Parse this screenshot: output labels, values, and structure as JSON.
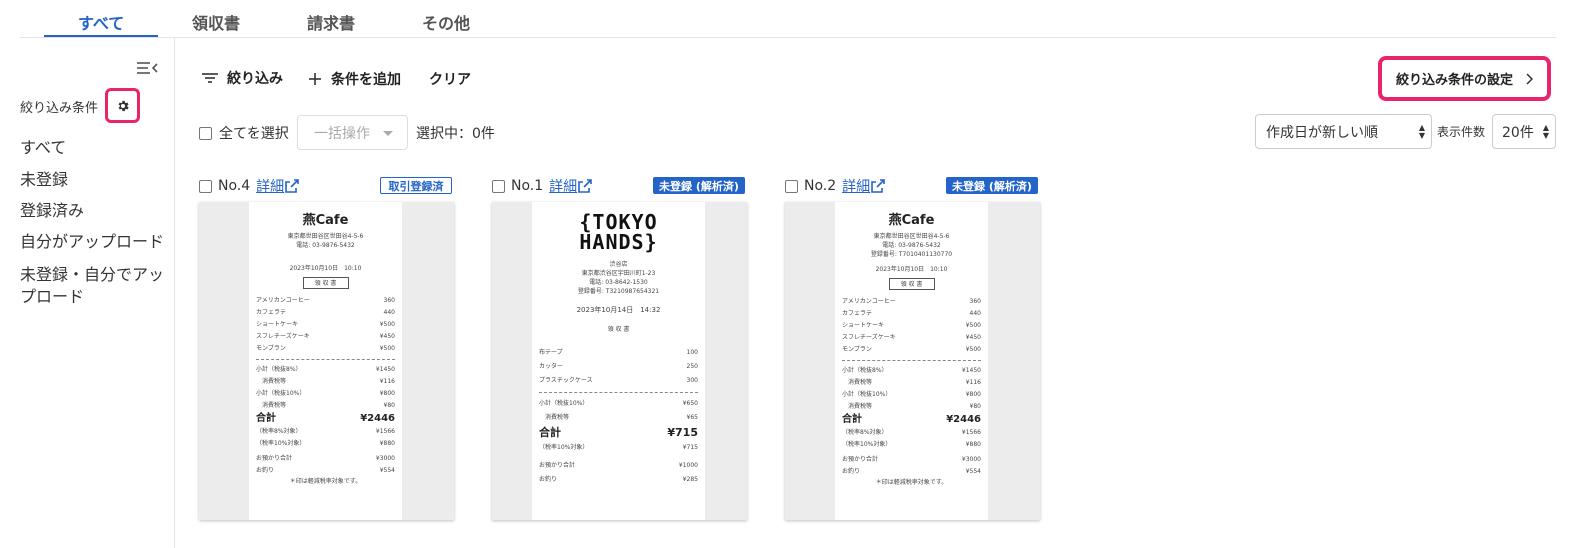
{
  "tabs": [
    {
      "label": "すべて"
    },
    {
      "label": "領収書"
    },
    {
      "label": "請求書"
    },
    {
      "label": "その他"
    }
  ],
  "colors": {
    "accent": "#2463c7",
    "highlight": "#e8246c"
  },
  "sidebar": {
    "header": "絞り込み条件",
    "items": [
      {
        "label": "すべて"
      },
      {
        "label": "未登録"
      },
      {
        "label": "登録済み"
      },
      {
        "label": "自分がアップロード"
      },
      {
        "label": "未登録・自分でアップロード"
      }
    ]
  },
  "toolbar": {
    "filter_label": "絞り込み",
    "add_condition_label": "条件を追加",
    "clear_label": "クリア",
    "filter_settings_label": "絞り込み条件の設定",
    "select_all_label": "全てを選択",
    "bulk_action_label": "一括操作",
    "selected_count_label": "選択中：0件",
    "sort_value": "作成日が新しい順",
    "per_page_label": "表示件数",
    "per_page_value": "20件"
  },
  "cards": [
    {
      "number": "No.4",
      "detail_label": "詳細",
      "badge": "取引登録済",
      "receipt": {
        "store": "燕Cafe",
        "address": "東京都世田谷区世田谷4-5-6",
        "phone": "電話: 03-9876-5432",
        "datetime": "2023年10月10日　10:10",
        "doc_title": "領 収 書",
        "items": [
          {
            "name": "アメリカンコーヒー",
            "price": "360"
          },
          {
            "name": "カフェラテ",
            "price": "440"
          },
          {
            "name": "ショートケーキ",
            "price": "¥500"
          },
          {
            "name": "スフレチーズケーキ",
            "price": "¥450"
          },
          {
            "name": "モンブラン",
            "price": "¥500"
          }
        ],
        "subtotals": [
          {
            "name": "小計（税抜8%）",
            "price": "¥1450"
          },
          {
            "name": "　消費税等",
            "price": "¥116"
          },
          {
            "name": "小計（税抜10%）",
            "price": "¥800"
          },
          {
            "name": "　消費税等",
            "price": "¥80"
          }
        ],
        "total_label": "合計",
        "total": "¥2446",
        "tax_breakdown": [
          {
            "name": "（税率8%対象）",
            "price": "¥1566"
          },
          {
            "name": "（税率10%対象）",
            "price": "¥880"
          }
        ],
        "payment": [
          {
            "name": "お預かり合計",
            "price": "¥3000"
          },
          {
            "name": "お釣り",
            "price": "¥554"
          }
        ],
        "note": "＊印は軽減税率対象です。"
      }
    },
    {
      "number": "No.1",
      "detail_label": "詳細",
      "badge": "未登録 (解析済)",
      "receipt": {
        "logo_line1": "{TOKYO",
        "logo_line2": "HANDS}",
        "store": "渋谷店",
        "address": "東京都渋谷区宇田川町1-23",
        "phone": "電話: 03-8642-1530",
        "registration": "登録番号: T3210987654321",
        "datetime": "2023年10月14日　14:32",
        "doc_title": "領 収 書",
        "items": [
          {
            "name": "布テープ",
            "price": "100"
          },
          {
            "name": "カッター",
            "price": "250"
          },
          {
            "name": "プラスチックケース",
            "price": "300"
          }
        ],
        "subtotals": [
          {
            "name": "小計（税抜10%）",
            "price": "¥650"
          },
          {
            "name": "　消費税等",
            "price": "¥65"
          }
        ],
        "total_label": "合計",
        "total": "¥715",
        "tax_breakdown": [
          {
            "name": "（税率10%対象）",
            "price": "¥715"
          }
        ],
        "payment": [
          {
            "name": "お預かり合計",
            "price": "¥1000"
          },
          {
            "name": "お釣り",
            "price": "¥285"
          }
        ]
      }
    },
    {
      "number": "No.2",
      "detail_label": "詳細",
      "badge": "未登録 (解析済)",
      "receipt": {
        "store": "燕Cafe",
        "address": "東京都世田谷区世田谷4-5-6",
        "phone": "電話: 03-9876-5432",
        "registration": "登録番号: T7010401130770",
        "datetime": "2023年10月10日　10:10",
        "doc_title": "領 収 書",
        "items": [
          {
            "name": "アメリカンコーヒー",
            "price": "360"
          },
          {
            "name": "カフェラテ",
            "price": "440"
          },
          {
            "name": "ショートケーキ",
            "price": "¥500"
          },
          {
            "name": "スフレチーズケーキ",
            "price": "¥450"
          },
          {
            "name": "モンブラン",
            "price": "¥500"
          }
        ],
        "subtotals": [
          {
            "name": "小計（税抜8%）",
            "price": "¥1450"
          },
          {
            "name": "　消費税等",
            "price": "¥116"
          },
          {
            "name": "小計（税抜10%）",
            "price": "¥800"
          },
          {
            "name": "　消費税等",
            "price": "¥80"
          }
        ],
        "total_label": "合計",
        "total": "¥2446",
        "tax_breakdown": [
          {
            "name": "（税率8%対象）",
            "price": "¥1566"
          },
          {
            "name": "（税率10%対象）",
            "price": "¥880"
          }
        ],
        "payment": [
          {
            "name": "お預かり合計",
            "price": "¥3000"
          },
          {
            "name": "お釣り",
            "price": "¥554"
          }
        ],
        "note": "＊印は軽減税率対象です。"
      }
    }
  ]
}
